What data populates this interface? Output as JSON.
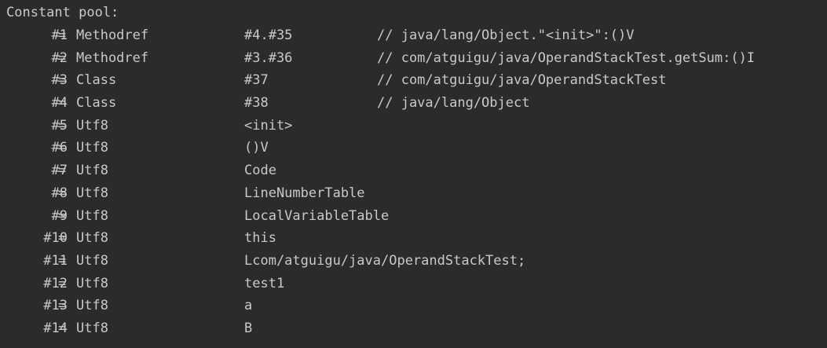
{
  "console": {
    "header": "Constant pool:",
    "rows": [
      {
        "index": "#1",
        "eq": "=",
        "type": "Methodref",
        "value": "#4.#35",
        "comment": "// java/lang/Object.\"<init>\":()V"
      },
      {
        "index": "#2",
        "eq": "=",
        "type": "Methodref",
        "value": "#3.#36",
        "comment": "// com/atguigu/java/OperandStackTest.getSum:()I"
      },
      {
        "index": "#3",
        "eq": "=",
        "type": "Class",
        "value": "#37",
        "comment": "// com/atguigu/java/OperandStackTest"
      },
      {
        "index": "#4",
        "eq": "=",
        "type": "Class",
        "value": "#38",
        "comment": "// java/lang/Object"
      },
      {
        "index": "#5",
        "eq": "=",
        "type": "Utf8",
        "value": "<init>",
        "comment": ""
      },
      {
        "index": "#6",
        "eq": "=",
        "type": "Utf8",
        "value": "()V",
        "comment": ""
      },
      {
        "index": "#7",
        "eq": "=",
        "type": "Utf8",
        "value": "Code",
        "comment": ""
      },
      {
        "index": "#8",
        "eq": "=",
        "type": "Utf8",
        "value": "LineNumberTable",
        "comment": ""
      },
      {
        "index": "#9",
        "eq": "=",
        "type": "Utf8",
        "value": "LocalVariableTable",
        "comment": ""
      },
      {
        "index": "#10",
        "eq": "=",
        "type": "Utf8",
        "value": "this",
        "comment": ""
      },
      {
        "index": "#11",
        "eq": "=",
        "type": "Utf8",
        "value": "Lcom/atguigu/java/OperandStackTest;",
        "comment": ""
      },
      {
        "index": "#12",
        "eq": "=",
        "type": "Utf8",
        "value": "test1",
        "comment": ""
      },
      {
        "index": "#13",
        "eq": "=",
        "type": "Utf8",
        "value": "a",
        "comment": ""
      },
      {
        "index": "#14",
        "eq": "=",
        "type": "Utf8",
        "value": "B",
        "comment": ""
      }
    ]
  },
  "colors": {
    "background": "#2b2b2b",
    "text": "#c9c9c9"
  }
}
